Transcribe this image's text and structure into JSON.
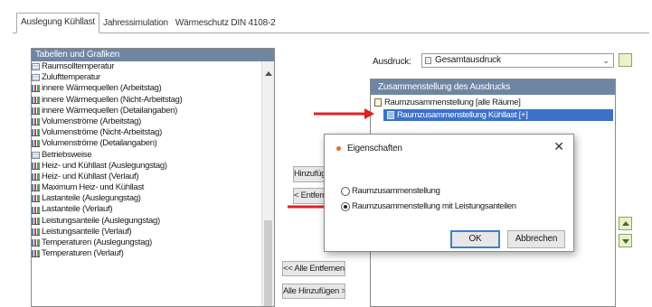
{
  "tabs": [
    {
      "label": "Auslegung Kühllast",
      "active": true
    },
    {
      "label": "Jahressimulation",
      "active": false
    },
    {
      "label": "Wärmeschutz DIN 4108-2",
      "active": false
    }
  ],
  "left_panel": {
    "header": "Tabellen und Grafiken",
    "items": [
      {
        "label": "Raumsolltemperatur",
        "icon": "table-icon"
      },
      {
        "label": "Zulufttemperatur",
        "icon": "table-icon"
      },
      {
        "label": "innere Wärmequellen (Arbeitstag)",
        "icon": "chart-icon"
      },
      {
        "label": "innere Wärmequellen (Nicht-Arbeitstag)",
        "icon": "chart-icon"
      },
      {
        "label": "innere Wärmequellen (Detailangaben)",
        "icon": "chart-icon"
      },
      {
        "label": "Volumenströme (Arbeitstag)",
        "icon": "chart-icon"
      },
      {
        "label": "Volumenströme (Nicht-Arbeitstag)",
        "icon": "chart-icon"
      },
      {
        "label": "Volumenströme (Detailangaben)",
        "icon": "chart-icon"
      },
      {
        "label": "Betriebsweise",
        "icon": "table-icon"
      },
      {
        "label": "Heiz- und Kühllast (Auslegungstag)",
        "icon": "chart-icon"
      },
      {
        "label": "Heiz- und Kühllast (Verlauf)",
        "icon": "chart-icon"
      },
      {
        "label": "Maximum Heiz- und Kühllast",
        "icon": "chart-icon"
      },
      {
        "label": "Lastanteile (Auslegungstag)",
        "icon": "chart-icon"
      },
      {
        "label": "Lastanteile (Verlauf)",
        "icon": "chart-icon"
      },
      {
        "label": "Leistungsanteile (Auslegungstag)",
        "icon": "chart-icon"
      },
      {
        "label": "Leistungsanteile (Verlauf)",
        "icon": "chart-icon"
      },
      {
        "label": "Temperaturen (Auslegungstag)",
        "icon": "chart-icon"
      },
      {
        "label": "Temperaturen (Verlauf)",
        "icon": "chart-icon"
      }
    ]
  },
  "middle_buttons": {
    "add": "Hinzufügen",
    "remove": "< Entfernen",
    "remove_all": "<< Alle Entfernen",
    "add_all": "Alle Hinzufügen >>"
  },
  "print": {
    "label": "Ausdruck:",
    "selected": "Gesamtausdruck"
  },
  "right_panel": {
    "header": "Zusammenstellung des Ausdrucks",
    "root": "Raumzusammenstellung [alle Räume]",
    "child": "Raumzusammenstellung Kühllast [+]"
  },
  "dialog": {
    "title": "Eigenschaften",
    "close": "✕",
    "option1": "Raumzusammenstellung",
    "option2": "Raumzusammenstellung mit Leistungsanteilen",
    "selected_option": 2,
    "ok": "OK",
    "cancel": "Abbrechen"
  },
  "colors": {
    "header_bg": "#6f86a3",
    "selection": "#3a72c8",
    "annotation_arrow": "#e02020"
  }
}
